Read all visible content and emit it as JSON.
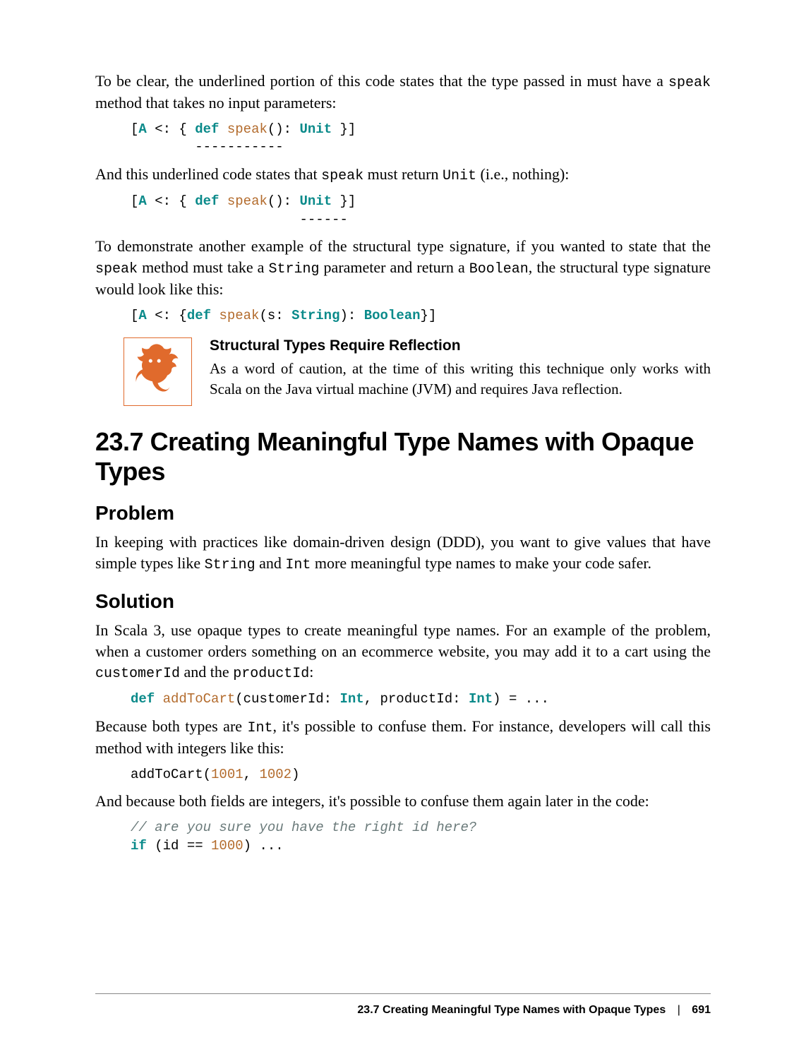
{
  "para1_a": "To be clear, the underlined portion of this code states that the type passed in must have a ",
  "para1_code": "speak",
  "para1_b": " method that takes no input parameters:",
  "code1": {
    "line": "[A <: { def speak(): Unit }]",
    "ul": "        -----------"
  },
  "para2_a": "And this underlined code states that ",
  "para2_code1": "speak",
  "para2_b": " must return ",
  "para2_code2": "Unit",
  "para2_c": " (i.e., nothing):",
  "code2": {
    "line": "[A <: { def speak(): Unit }]",
    "ul": "                     ------"
  },
  "para3_a": "To demonstrate another example of the structural type signature, if you wanted to state that the ",
  "para3_code1": "speak",
  "para3_b": " method must take a ",
  "para3_code2": "String",
  "para3_c": " parameter and return a ",
  "para3_code3": "Boolean",
  "para3_d": ", the structural type signature would look like this:",
  "code3": "[A <: {def speak(s: String): Boolean}]",
  "note": {
    "title": "Structural Types Require Reflection",
    "text": "As a word of caution, at the time of this writing this technique only works with Scala on the Java virtual machine (JVM) and requires Java reflection."
  },
  "section_heading": "23.7 Creating Meaningful Type Names with Opaque Types",
  "problem_heading": "Problem",
  "problem": {
    "a": "In keeping with practices like domain-driven design (DDD), you want to give values that have simple types like ",
    "code1": "String",
    "b": " and ",
    "code2": "Int",
    "c": " more meaningful type names to make your code safer."
  },
  "solution_heading": "Solution",
  "solution_p1": {
    "a": "In Scala 3, use opaque types to create meaningful type names. For an example of the problem, when a customer orders something on an ecommerce website, you may add it to a cart using the ",
    "code1": "customerId",
    "b": " and the ",
    "code2": "productId",
    "c": ":"
  },
  "code4": "def addToCart(customerId: Int, productId: Int) = ...",
  "solution_p2": {
    "a": "Because both types are ",
    "code1": "Int",
    "b": ", it's possible to confuse them. For instance, developers will call this method with integers like this:"
  },
  "code5": "addToCart(1001, 1002)",
  "solution_p3": "And because both fields are integers, it's possible to confuse them again later in the code:",
  "code6": {
    "comment": "// are you sure you have the right id here?",
    "line": "if (id == 1000) ..."
  },
  "footer": {
    "title": "23.7 Creating Meaningful Type Names with Opaque Types",
    "sep": "|",
    "page": "691"
  }
}
